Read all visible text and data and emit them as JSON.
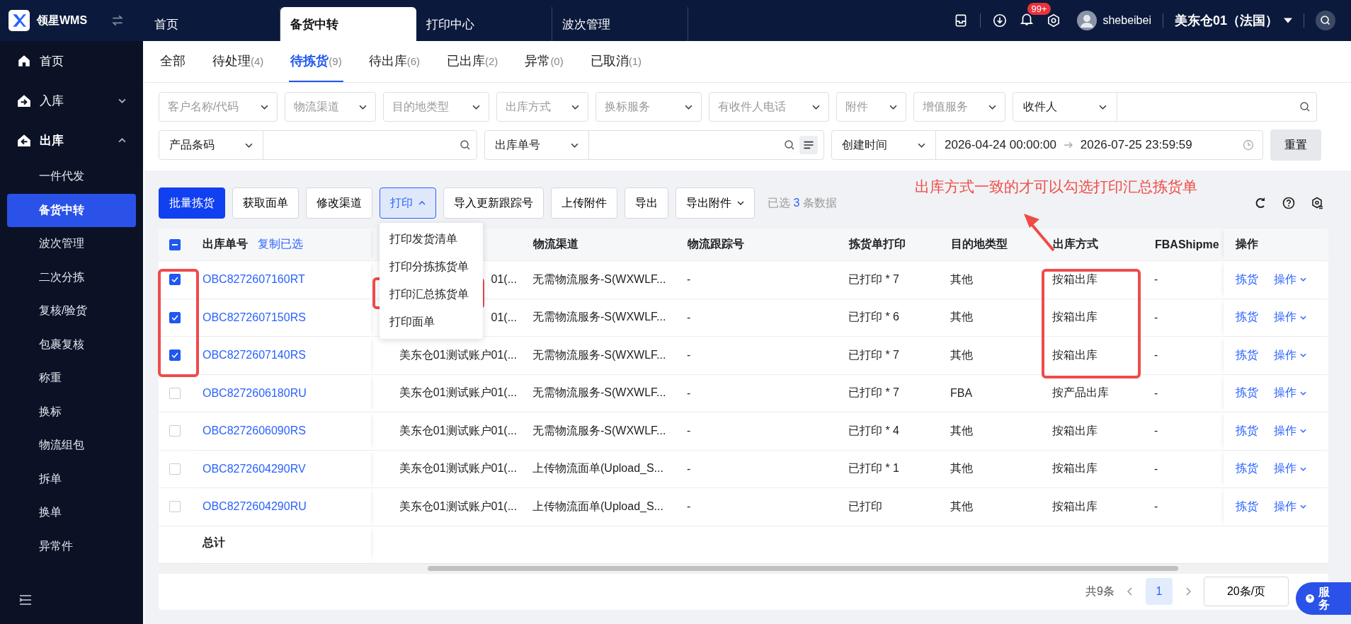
{
  "brand": {
    "name": "领星WMS"
  },
  "top_tabs": [
    {
      "label": "首页",
      "selected": false
    },
    {
      "label": "备货中转",
      "selected": true
    },
    {
      "label": "打印中心",
      "selected": false
    },
    {
      "label": "波次管理",
      "selected": false
    }
  ],
  "header": {
    "badge": "99+",
    "user": "shebeibei",
    "warehouse": "美东仓01（法国）"
  },
  "sidebar": {
    "items": [
      {
        "label": "首页",
        "kind": "link",
        "expanded": false
      },
      {
        "label": "入库",
        "kind": "group",
        "expanded": false
      },
      {
        "label": "出库",
        "kind": "group",
        "expanded": true,
        "children": [
          {
            "label": "一件代发",
            "selected": false
          },
          {
            "label": "备货中转",
            "selected": true
          },
          {
            "label": "波次管理",
            "selected": false
          },
          {
            "label": "二次分拣",
            "selected": false
          },
          {
            "label": "复核/验货",
            "selected": false
          },
          {
            "label": "包裹复核",
            "selected": false
          },
          {
            "label": "称重",
            "selected": false
          },
          {
            "label": "换标",
            "selected": false
          },
          {
            "label": "物流组包",
            "selected": false
          },
          {
            "label": "拆单",
            "selected": false
          },
          {
            "label": "换单",
            "selected": false
          },
          {
            "label": "异常件",
            "selected": false
          }
        ]
      }
    ]
  },
  "status_tabs": [
    {
      "label": "全部",
      "selected": false
    },
    {
      "label": "待处理",
      "count": "(4)",
      "selected": false
    },
    {
      "label": "待拣货",
      "count": "(9)",
      "selected": true
    },
    {
      "label": "待出库",
      "count": "(6)",
      "selected": false
    },
    {
      "label": "已出库",
      "count": "(2)",
      "selected": false
    },
    {
      "label": "异常",
      "count": "(0)",
      "selected": false
    },
    {
      "label": "已取消",
      "count": "(1)",
      "selected": false
    }
  ],
  "filters": {
    "row_1": [
      {
        "placeholder": "客户名称/代码"
      },
      {
        "placeholder": "物流渠道"
      },
      {
        "placeholder": "目的地类型"
      },
      {
        "placeholder": "出库方式"
      },
      {
        "placeholder": "换标服务"
      },
      {
        "placeholder": "有收件人电话"
      },
      {
        "placeholder": "附件"
      },
      {
        "placeholder": "增值服务"
      }
    ],
    "recipient": {
      "field": "收件人"
    },
    "row_2": [
      {
        "field": "产品条码"
      },
      {
        "field": "出库单号"
      }
    ],
    "date": {
      "field": "创建时间",
      "start": "2026-04-24 00:00:00",
      "end": "2026-07-25 23:59:59"
    },
    "reset": "重置"
  },
  "toolbar": {
    "buttons": [
      {
        "label": "批量拣货",
        "kind": "primary"
      },
      {
        "label": "获取面单",
        "kind": "plain"
      },
      {
        "label": "修改渠道",
        "kind": "plain"
      },
      {
        "label": "打印",
        "kind": "open"
      },
      {
        "label": "导入更新跟踪号",
        "kind": "plain"
      },
      {
        "label": "上传附件",
        "kind": "plain"
      },
      {
        "label": "导出",
        "kind": "plain"
      },
      {
        "label": "导出附件",
        "kind": "menu"
      }
    ],
    "selected_prefix": "已选",
    "selected_count": "3",
    "selected_suffix": "条数据"
  },
  "print_menu": [
    "打印发货清单",
    "打印分拣拣货单",
    "打印汇总拣货单",
    "打印面单"
  ],
  "annotation": {
    "note": "出库方式一致的才可以勾选打印汇总拣货单"
  },
  "table": {
    "select_all": {
      "indeterminate": true
    },
    "copy_link": "复制已选",
    "columns": [
      {
        "label": "出库单号"
      },
      {},
      {
        "label": "物流渠道"
      },
      {
        "label": "物流跟踪号"
      },
      {
        "label": "拣货单打印"
      },
      {
        "label": "目的地类型"
      },
      {
        "label": "出库方式"
      },
      {
        "label": "FBAShipme"
      },
      {
        "label": "操作"
      }
    ],
    "rows": [
      {
        "checked": true,
        "id": "OBC8272607160RT",
        "customer": "01(...",
        "channel": "无需物流服务-S(WXWLF...",
        "tracking": "-",
        "print": "已打印 * 7",
        "dest": "其他",
        "method": "按箱出库",
        "fba": "-",
        "pick": "拣货",
        "ops": "操作"
      },
      {
        "checked": true,
        "id": "OBC8272607150RS",
        "customer": "01(...",
        "channel": "无需物流服务-S(WXWLF...",
        "tracking": "-",
        "print": "已打印 * 6",
        "dest": "其他",
        "method": "按箱出库",
        "fba": "-",
        "pick": "拣货",
        "ops": "操作"
      },
      {
        "checked": true,
        "id": "OBC8272607140RS",
        "customer": "美东仓01测试账户01(...",
        "channel": "无需物流服务-S(WXWLF...",
        "tracking": "-",
        "print": "已打印 * 7",
        "dest": "其他",
        "method": "按箱出库",
        "fba": "-",
        "pick": "拣货",
        "ops": "操作"
      },
      {
        "checked": false,
        "id": "OBC8272606180RU",
        "customer": "美东仓01测试账户01(...",
        "channel": "无需物流服务-S(WXWLF...",
        "tracking": "-",
        "print": "已打印 * 7",
        "dest": "FBA",
        "method": "按产品出库",
        "fba": "-",
        "pick": "拣货",
        "ops": "操作"
      },
      {
        "checked": false,
        "id": "OBC8272606090RS",
        "customer": "美东仓01测试账户01(...",
        "channel": "无需物流服务-S(WXWLF...",
        "tracking": "-",
        "print": "已打印 * 4",
        "dest": "其他",
        "method": "按箱出库",
        "fba": "-",
        "pick": "拣货",
        "ops": "操作"
      },
      {
        "checked": false,
        "id": "OBC8272604290RV",
        "customer": "美东仓01测试账户01(...",
        "channel": "上传物流面单(Upload_S...",
        "tracking": "-",
        "print": "已打印 * 1",
        "dest": "其他",
        "method": "按箱出库",
        "fba": "-",
        "pick": "拣货",
        "ops": "操作"
      },
      {
        "checked": false,
        "id": "OBC8272604290RU",
        "customer": "美东仓01测试账户01(...",
        "channel": "上传物流面单(Upload_S...",
        "tracking": "-",
        "print": "已打印",
        "dest": "其他",
        "method": "按箱出库",
        "fba": "-",
        "pick": "拣货",
        "ops": "操作"
      }
    ],
    "total": "总计"
  },
  "pagination": {
    "total": "共9条",
    "pages": [
      {
        "label": "1",
        "selected": true
      }
    ],
    "page_size": "20条/页"
  },
  "service": {
    "label": "服务"
  }
}
